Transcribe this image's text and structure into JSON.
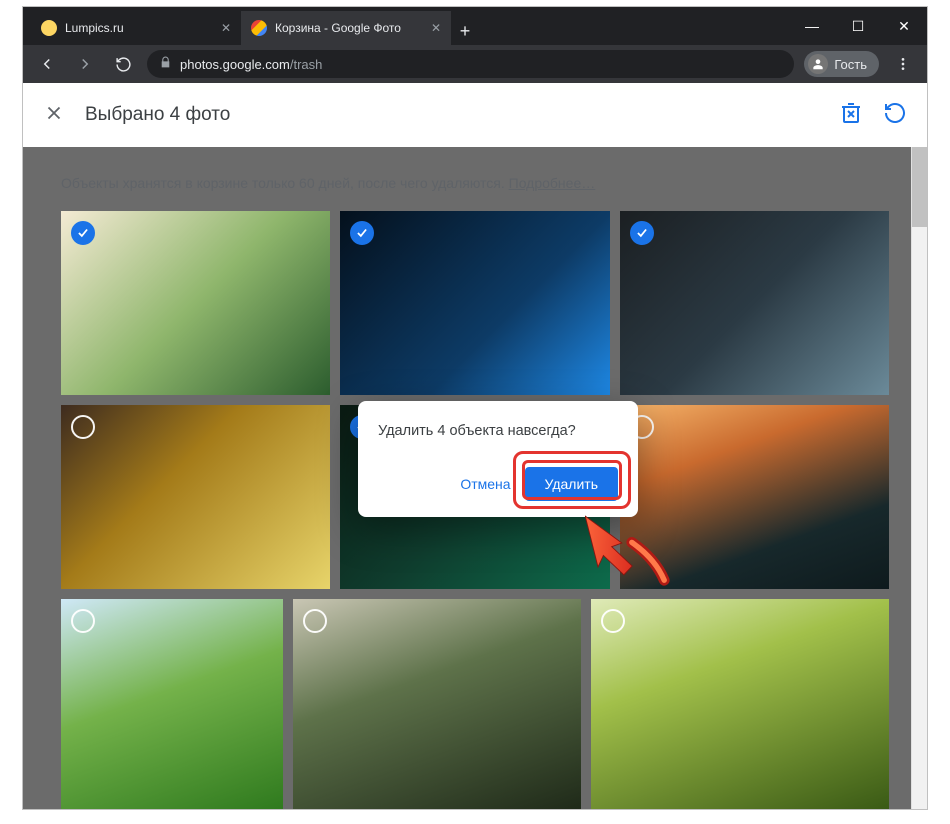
{
  "window": {
    "minimize": "—",
    "maximize": "☐",
    "close": "✕"
  },
  "tabs": [
    {
      "title": "Lumpics.ru",
      "active": false
    },
    {
      "title": "Корзина - Google Фото",
      "active": true
    }
  ],
  "new_tab": "+",
  "address": {
    "host": "photos.google.com",
    "path": "/trash"
  },
  "profile": {
    "label": "Гость"
  },
  "selection_bar": {
    "text": "Выбрано 4 фото"
  },
  "info_bar": {
    "text": "Объекты хранятся в корзине только 60 дней, после чего удаляются. ",
    "link": "Подробнее…"
  },
  "photos": [
    {
      "selected": true,
      "name": "photo-1"
    },
    {
      "selected": true,
      "name": "photo-2"
    },
    {
      "selected": true,
      "name": "photo-3"
    },
    {
      "selected": false,
      "name": "photo-4"
    },
    {
      "selected": true,
      "name": "photo-5"
    },
    {
      "selected": false,
      "name": "photo-6"
    },
    {
      "selected": false,
      "name": "photo-7"
    },
    {
      "selected": false,
      "name": "photo-8"
    },
    {
      "selected": false,
      "name": "photo-9"
    }
  ],
  "dialog": {
    "message": "Удалить 4 объекта навсегда?",
    "cancel": "Отмена",
    "confirm": "Удалить"
  }
}
